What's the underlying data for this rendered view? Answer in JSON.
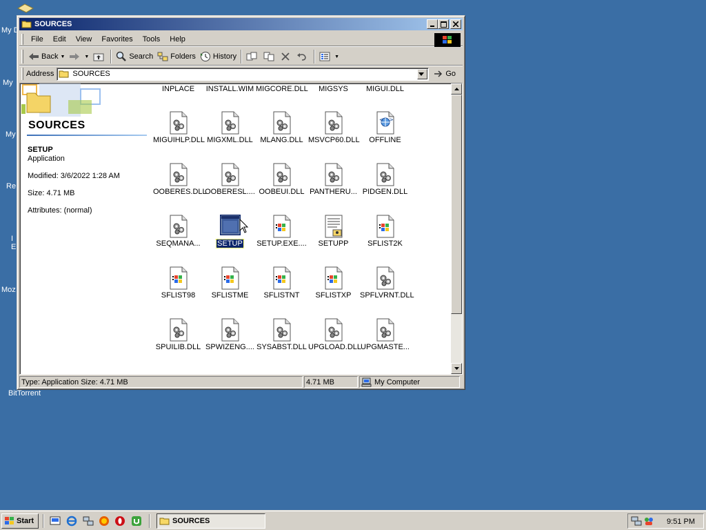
{
  "desktop": {
    "labels": [
      "My D",
      "My",
      "My",
      "Re",
      "I",
      "E",
      "Moz",
      "BitTorrent"
    ]
  },
  "window": {
    "title": "SOURCES",
    "controls": {
      "minimize": "_",
      "maximize": "□",
      "close": "✕"
    }
  },
  "menu": [
    "File",
    "Edit",
    "View",
    "Favorites",
    "Tools",
    "Help"
  ],
  "toolbar": {
    "back": "Back",
    "search": "Search",
    "folders": "Folders",
    "history": "History"
  },
  "address": {
    "label": "Address",
    "value": "SOURCES",
    "go": "Go"
  },
  "left_panel": {
    "folder_title": "SOURCES",
    "selected_name": "SETUP",
    "selected_type": "Application",
    "modified": "Modified: 3/6/2022 1:28 AM",
    "size": "Size: 4.71 MB",
    "attributes": "Attributes: (normal)"
  },
  "files": {
    "top_row": [
      "INPLACE",
      "INSTALL.WIM",
      "MIGCORE.DLL",
      "MIGSYS",
      "MIGUI.DLL"
    ],
    "rows": [
      [
        {
          "name": "MIGUIHLP.DLL",
          "icon": "dll-gear-icon"
        },
        {
          "name": "MIGXML.DLL",
          "icon": "dll-gear-icon"
        },
        {
          "name": "MLANG.DLL",
          "icon": "dll-gear-icon"
        },
        {
          "name": "MSVCP60.DLL",
          "icon": "dll-gear-icon"
        },
        {
          "name": "OFFLINE",
          "icon": "web-file-icon"
        }
      ],
      [
        {
          "name": "OOBERES.DLL",
          "icon": "dll-gear-icon"
        },
        {
          "name": "OOBERESL....",
          "icon": "dll-gear-icon"
        },
        {
          "name": "OOBEUI.DLL",
          "icon": "dll-gear-icon"
        },
        {
          "name": "PANTHERU...",
          "icon": "dll-gear-icon"
        },
        {
          "name": "PIDGEN.DLL",
          "icon": "dll-gear-icon"
        }
      ],
      [
        {
          "name": "SEQMANA...",
          "icon": "dll-gear-icon"
        },
        {
          "name": "SETUP",
          "icon": "application-icon",
          "selected": true
        },
        {
          "name": "SETUP.EXE....",
          "icon": "windows-file-icon"
        },
        {
          "name": "SETUPP",
          "icon": "text-settings-icon"
        },
        {
          "name": "SFLIST2K",
          "icon": "windows-file-icon"
        }
      ],
      [
        {
          "name": "SFLIST98",
          "icon": "windows-file-icon"
        },
        {
          "name": "SFLISTME",
          "icon": "windows-file-icon"
        },
        {
          "name": "SFLISTNT",
          "icon": "windows-file-icon"
        },
        {
          "name": "SFLISTXP",
          "icon": "windows-file-icon"
        },
        {
          "name": "SPFLVRNT.DLL",
          "icon": "dll-gear-icon"
        }
      ],
      [
        {
          "name": "SPUILIB.DLL",
          "icon": "dll-gear-icon"
        },
        {
          "name": "SPWIZENG....",
          "icon": "dll-gear-icon"
        },
        {
          "name": "SYSABST.DLL",
          "icon": "dll-gear-icon"
        },
        {
          "name": "UPGLOAD.DLL",
          "icon": "dll-gear-icon"
        },
        {
          "name": "UPGMASTE...",
          "icon": "dll-gear-icon"
        }
      ]
    ]
  },
  "status": {
    "info": "Type: Application Size: 4.71 MB",
    "size": "4.71 MB",
    "zone": "My Computer"
  },
  "taskbar": {
    "start": "Start",
    "task": "SOURCES",
    "clock": "9:51 PM"
  }
}
